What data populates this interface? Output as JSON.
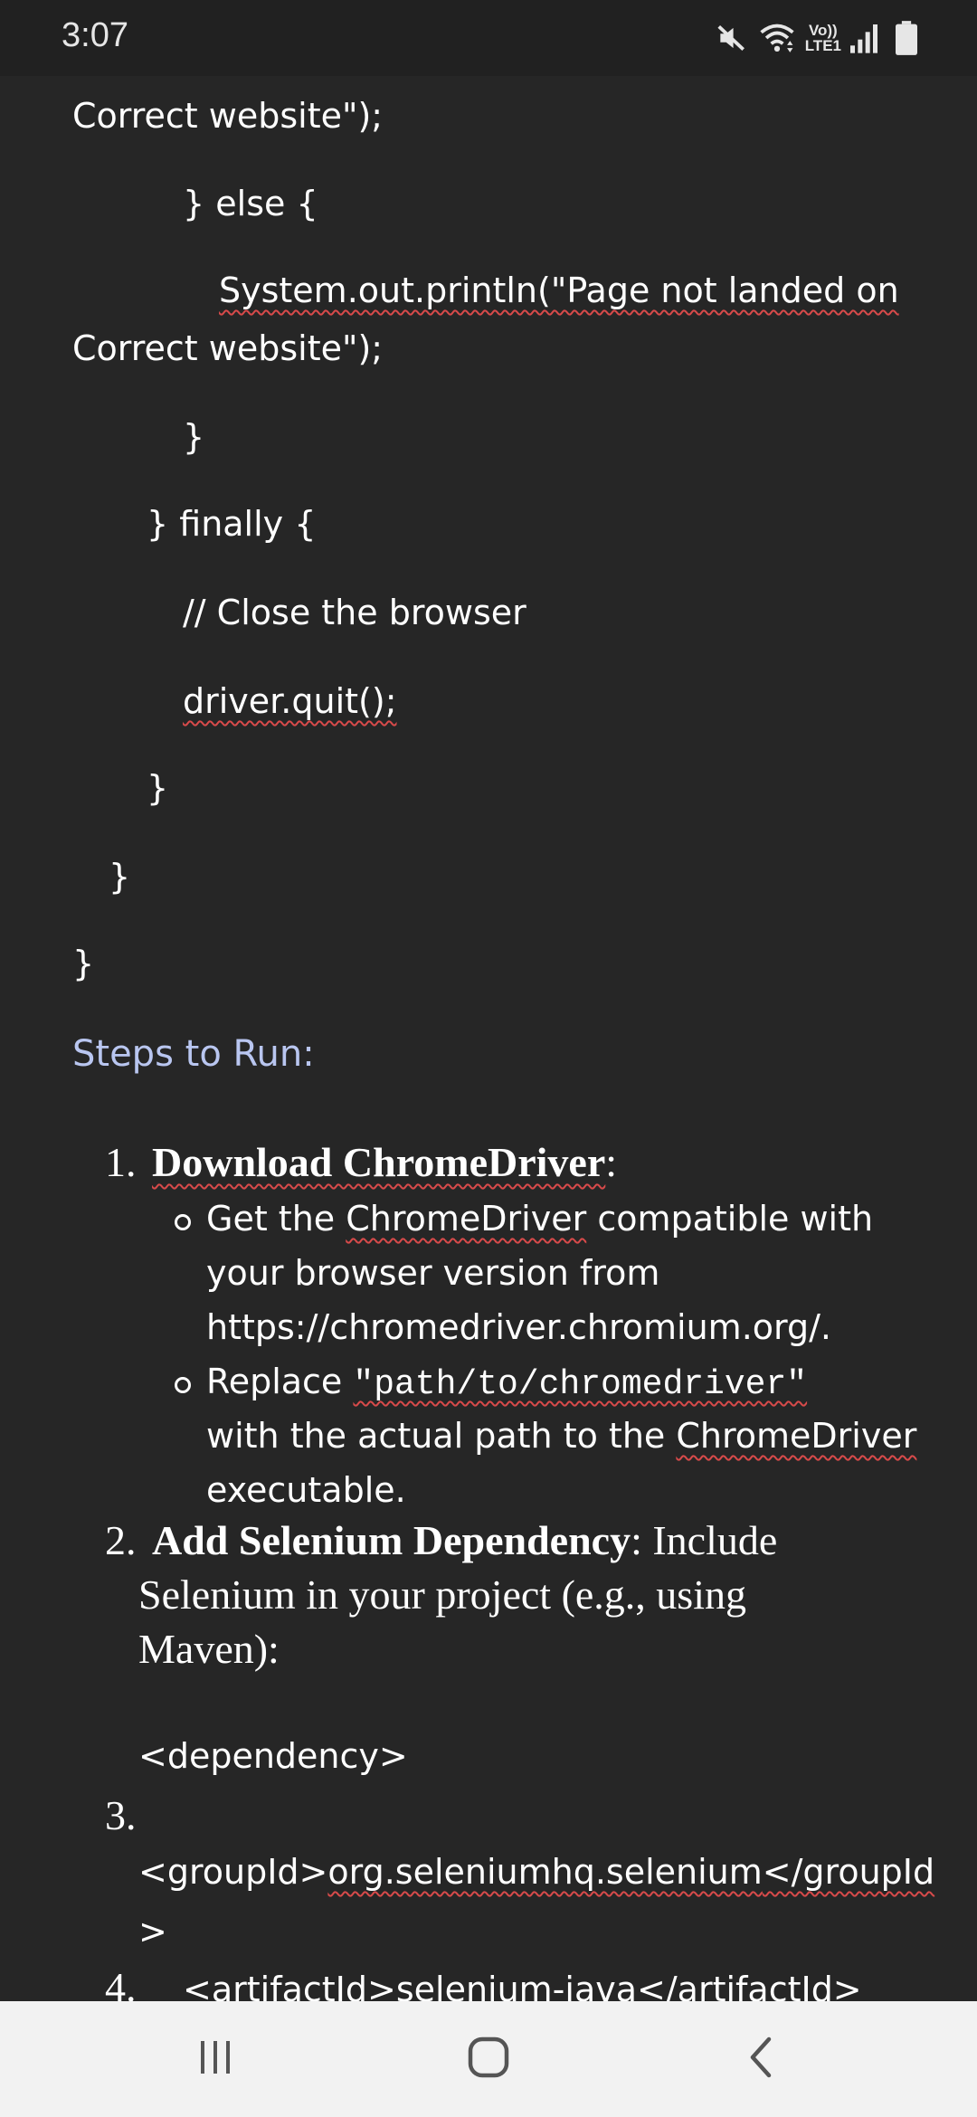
{
  "status_bar": {
    "time": "3:07",
    "lte_top": "Vo))",
    "lte_bottom": "LTE1",
    "icons": [
      "mute-icon",
      "wifi-icon",
      "signal-icon",
      "battery-icon"
    ]
  },
  "document": {
    "code_lines": [
      "Correct website\");",
      "} else {",
      "System.out.println(\"Page not landed on",
      "Correct website\");",
      "}",
      "} finally {",
      "// Close the browser",
      "driver.quit();",
      "}",
      "}",
      "}"
    ],
    "steps_heading": "Steps to Run:",
    "step1": {
      "number": "1.",
      "title": "Download ChromeDriver",
      "suffix": ":",
      "bullet1": {
        "pre": "Get the ",
        "link": "ChromeDriver",
        "post": " compatible with",
        "line2": "your browser version from",
        "line3": "https://chromedriver.chromium.org/."
      },
      "bullet2": {
        "pre": "Replace ",
        "code": "\"path/to/chromedriver\"",
        "line2_pre": "with the actual path to the ",
        "line2_link": "ChromeDriver",
        "line3": "executable."
      }
    },
    "step2": {
      "number": "2.",
      "title": "Add Selenium Dependency",
      "suffix": ": Include",
      "line2": "Selenium in your project (e.g., using",
      "line3": "Maven):"
    },
    "xml": {
      "dependency": "<dependency>",
      "step3_number": "3.",
      "groupid_open": "<groupId>",
      "groupid_value": "org.seleniumhq.selenium",
      "groupid_close": "</groupId",
      "groupid_wrap": ">",
      "step4_number": "4.",
      "artifact": "<artifactId>selenium-java</artifactId>"
    }
  },
  "nav_bar": {
    "recents": "recents-icon",
    "home": "home-icon",
    "back": "back-icon"
  }
}
